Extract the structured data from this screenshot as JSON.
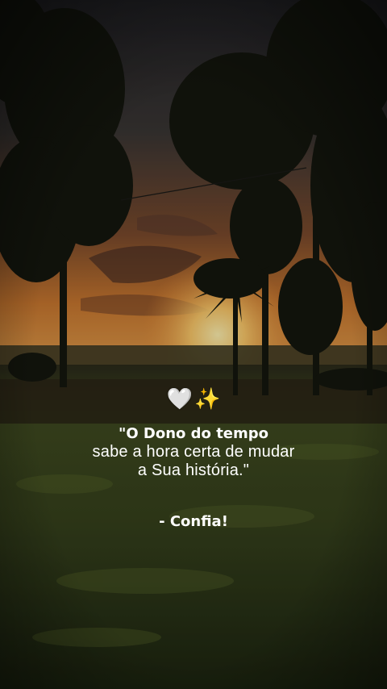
{
  "emojis": {
    "heart": "🤍",
    "sparkles": "✨"
  },
  "quote": {
    "line1": "\"O Dono do tempo",
    "line2": "sabe a hora certa de mudar",
    "line3": "a Sua história.\""
  },
  "signature": "- Confia!",
  "colors": {
    "sky_top": "#2b2b30",
    "sky_glow": "#d98a3a",
    "sun": "#ffd77a",
    "grass": "#3d4a1f",
    "tree_silhouette": "#15170f"
  }
}
